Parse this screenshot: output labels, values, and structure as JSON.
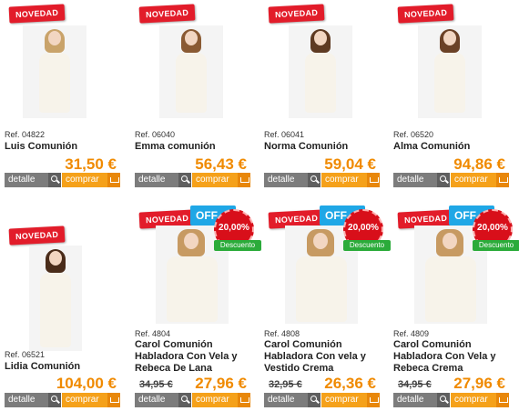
{
  "badges": {
    "new": "NOVEDAD",
    "off": "OFF",
    "discount_label": "Descuento"
  },
  "buttons": {
    "detail": "detalle",
    "buy": "comprar"
  },
  "products": [
    {
      "ref": "Ref. 04822",
      "name": "Luis Comunión",
      "price": "31,50 €",
      "old_price": "",
      "discount": "",
      "hair": "#c9a36a"
    },
    {
      "ref": "Ref. 06040",
      "name": "Emma comunión",
      "price": "56,43 €",
      "old_price": "",
      "discount": "",
      "hair": "#8a5a33"
    },
    {
      "ref": "Ref. 06041",
      "name": "Norma Comunión",
      "price": "59,04 €",
      "old_price": "",
      "discount": "",
      "hair": "#5e3a22"
    },
    {
      "ref": "Ref. 06520",
      "name": "Alma Comunión",
      "price": "94,86 €",
      "old_price": "",
      "discount": "",
      "hair": "#6b4126"
    },
    {
      "ref": "Ref. 06521",
      "name": "Lidia Comunión",
      "price": "104,00 €",
      "old_price": "",
      "discount": "",
      "hair": "#4a2c1a"
    },
    {
      "ref": "Ref. 4804",
      "name": "Carol Comunión Habladora Con Vela y Rebeca De Lana",
      "price": "27,96 €",
      "old_price": "34,95 €",
      "discount": "20,00%",
      "hair": "#c79a62"
    },
    {
      "ref": "Ref. 4808",
      "name": "Carol Comunión Habladora Con vela y Vestido Crema",
      "price": "26,36 €",
      "old_price": "32,95 €",
      "discount": "20,00%",
      "hair": "#c79a62"
    },
    {
      "ref": "Ref. 4809",
      "name": "Carol Comunión Habladora Con Vela y Rebeca Crema",
      "price": "27,96 €",
      "old_price": "34,95 €",
      "discount": "20,00%",
      "hair": "#c79a62"
    }
  ]
}
